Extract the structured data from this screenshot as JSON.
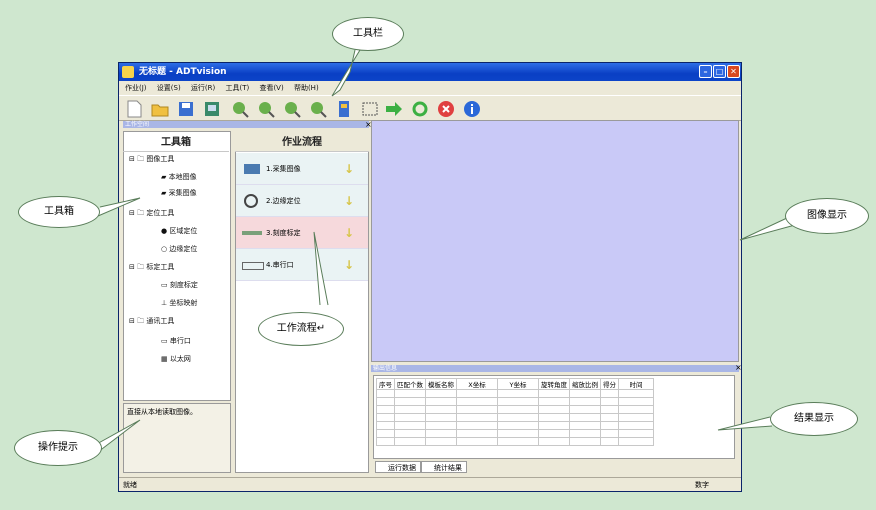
{
  "window": {
    "title": "无标题 - ADTvision",
    "min": "–",
    "max": "□",
    "close": "✕"
  },
  "menu": [
    "作业(J)",
    "设置(S)",
    "运行(R)",
    "工具(T)",
    "查看(V)",
    "帮助(H)"
  ],
  "toolbar_icons": [
    "new-file-icon",
    "open-folder-icon",
    "save-icon",
    "save-image-icon",
    "zoom-in-icon",
    "zoom-out-icon",
    "zoom-fit-icon",
    "zoom-original-icon",
    "film-icon",
    "select-rect-icon",
    "run-arrow-icon",
    "loop-run-icon",
    "stop-icon",
    "info-icon"
  ],
  "workspace_header": "工作空间",
  "workspace_close": "×",
  "toolbox": {
    "title": "工具箱",
    "groups": [
      {
        "label": "图像工具",
        "items": [
          "本地图像",
          "采集图像"
        ]
      },
      {
        "label": "定位工具",
        "items": [
          "区域定位",
          "边缘定位"
        ]
      },
      {
        "label": "标定工具",
        "items": [
          "刻度标定",
          "坐标映射"
        ]
      },
      {
        "label": "通讯工具",
        "items": [
          "串行口",
          "以太网"
        ]
      }
    ]
  },
  "flow": {
    "title": "作业流程",
    "steps": [
      "1.采集图像",
      "2.边缘定位",
      "3.刻度标定",
      "4.串行口"
    ],
    "arrow": "↓"
  },
  "hint_text": "直接从本地读取图像。",
  "results": {
    "header": "输出信息",
    "close": "×",
    "columns": [
      "序号",
      "匹配个数",
      "模板名称",
      "X坐标",
      "Y坐标",
      "旋转角度",
      "缩放比例",
      "得分",
      "时间"
    ],
    "tabs": [
      "运行数据",
      "统计结果"
    ]
  },
  "status": {
    "left": "就绪",
    "right": "数字"
  },
  "callouts": {
    "toolbar": "工具栏",
    "toolbox": "工具箱",
    "image_display": "图像显示",
    "workflow": "工作流程↵",
    "result_display": "结果显示",
    "operation_hint": "操作提示"
  },
  "colors": {
    "image_area": "#c9c9f7",
    "flow_step_1": "#eaf3f4",
    "flow_step_3": "#f6d9dc",
    "background": "#cfe7cf"
  }
}
